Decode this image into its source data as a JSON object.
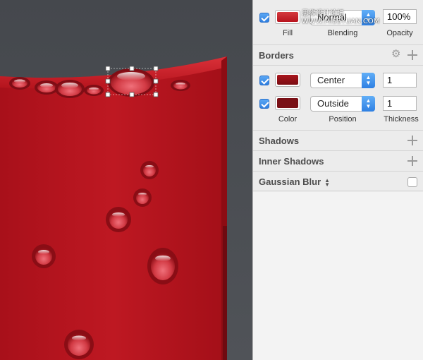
{
  "watermark": "思缘设计论坛 WWW.MISSYUAN.COM",
  "fill": {
    "enabled": true,
    "color": "#d43a3e",
    "blending": "Normal",
    "opacity": "100%",
    "labels": {
      "fill": "Fill",
      "blending": "Blending",
      "opacity": "Opacity"
    }
  },
  "borders": {
    "title": "Borders",
    "rows": [
      {
        "enabled": true,
        "color": "#a9161d",
        "position": "Center",
        "thickness": "1"
      },
      {
        "enabled": true,
        "color": "#7a1016",
        "position": "Outside",
        "thickness": "1"
      }
    ],
    "labels": {
      "color": "Color",
      "position": "Position",
      "thickness": "Thickness"
    }
  },
  "shadows": {
    "title": "Shadows"
  },
  "inner_shadows": {
    "title": "Inner Shadows"
  },
  "gaussian_blur": {
    "title": "Gaussian Blur",
    "enabled": false
  },
  "icons": {
    "add": "plus-icon",
    "settings": "gear-icon",
    "popup": "up-down-arrows-icon"
  },
  "colors": {
    "canvas": "#4a4d52",
    "liquid": "#b8141e",
    "accent": "#2f7fe0"
  }
}
